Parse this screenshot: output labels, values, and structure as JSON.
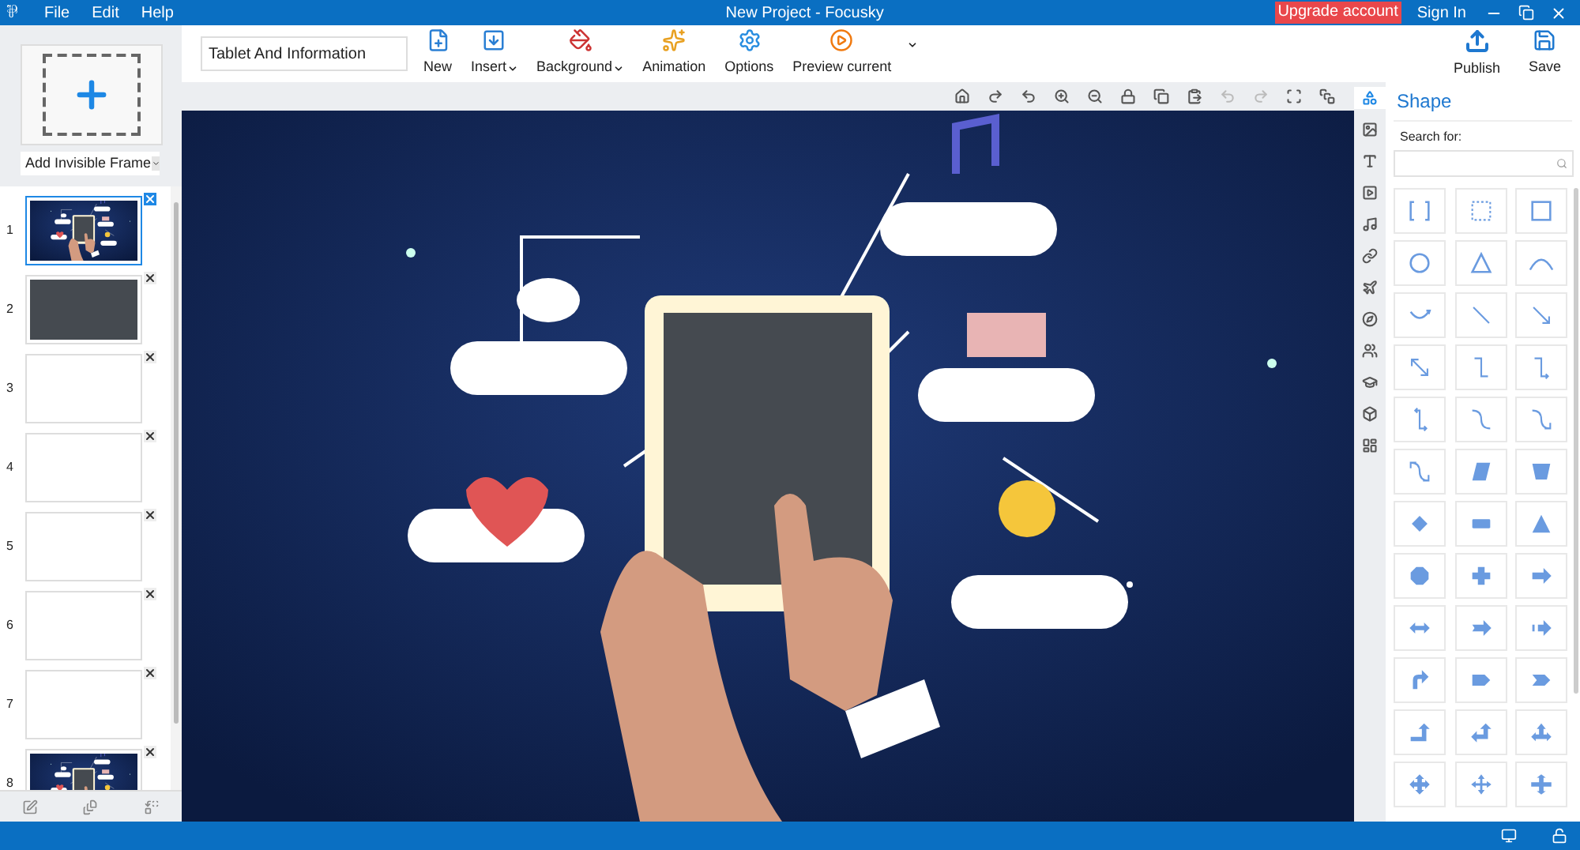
{
  "window": {
    "app_icon": "⅌",
    "menu": [
      "File",
      "Edit",
      "Help"
    ],
    "title": "New Project - Focusky",
    "upgrade": "Upgrade account",
    "sign_in": "Sign In"
  },
  "toolbar": {
    "project_name": "Tablet And Information",
    "buttons": [
      {
        "label": "New",
        "dropdown": false
      },
      {
        "label": "Insert",
        "dropdown": true
      },
      {
        "label": "Background",
        "dropdown": true
      },
      {
        "label": "Animation",
        "dropdown": false
      },
      {
        "label": "Options",
        "dropdown": false
      },
      {
        "label": "Preview current",
        "dropdown": false
      }
    ],
    "publish": "Publish",
    "save": "Save"
  },
  "frames_panel": {
    "add_frame": "Add Invisible Frame",
    "frames": [
      {
        "number": "1",
        "selected": true,
        "kind": "picture"
      },
      {
        "number": "2",
        "selected": false,
        "kind": "dark"
      },
      {
        "number": "3",
        "selected": false,
        "kind": "blank"
      },
      {
        "number": "4",
        "selected": false,
        "kind": "blank"
      },
      {
        "number": "5",
        "selected": false,
        "kind": "blank"
      },
      {
        "number": "6",
        "selected": false,
        "kind": "blank"
      },
      {
        "number": "7",
        "selected": false,
        "kind": "blank"
      },
      {
        "number": "8",
        "selected": false,
        "kind": "picture"
      }
    ]
  },
  "side_tabs": [
    {
      "selected": true
    },
    {
      "selected": false
    },
    {
      "selected": false
    },
    {
      "selected": false
    },
    {
      "selected": false
    },
    {
      "selected": false
    },
    {
      "selected": false
    },
    {
      "selected": false
    },
    {
      "selected": false
    },
    {
      "selected": false
    },
    {
      "selected": false
    },
    {
      "selected": false
    }
  ],
  "shape_panel": {
    "title": "Shape",
    "search_label": "Search for:"
  }
}
